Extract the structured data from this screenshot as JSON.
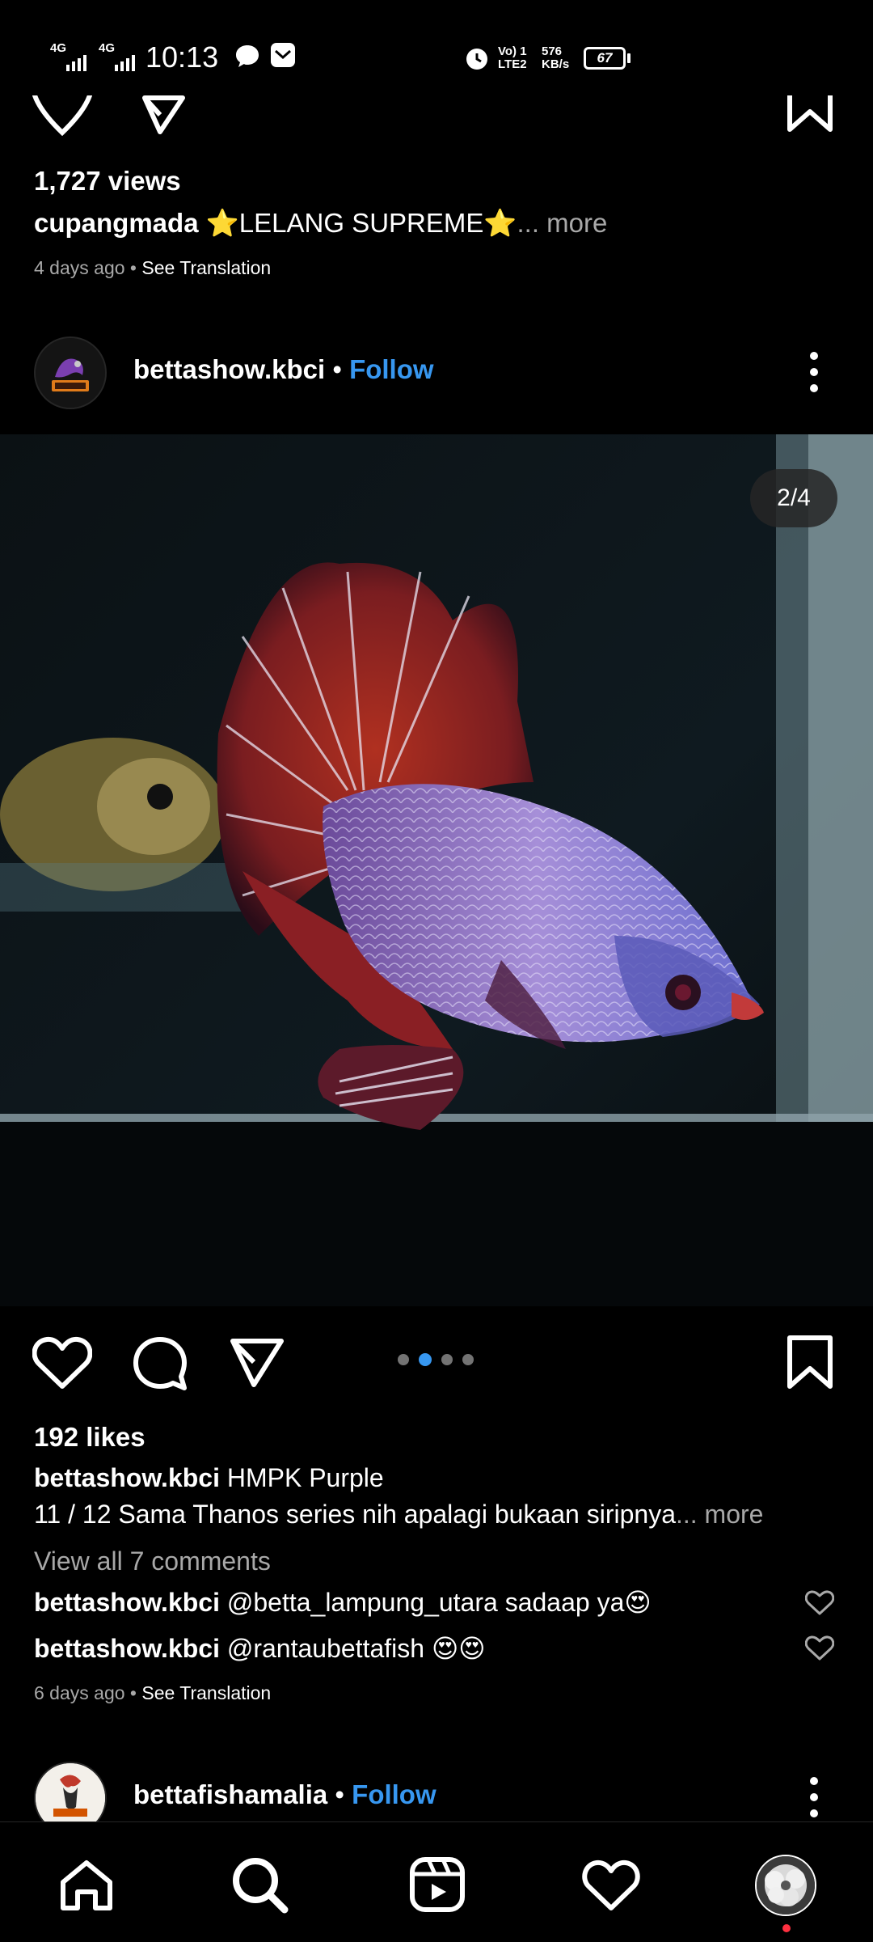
{
  "status_bar": {
    "time": "10:13",
    "net1": "4G",
    "net2": "4G",
    "volte_top": "Vo) 1",
    "volte_bottom": "LTE2",
    "speed_value": "576",
    "speed_unit": "KB/s",
    "battery": "67"
  },
  "prev_post": {
    "views": "1,727 views",
    "caption_user": "cupangmada",
    "caption_text": "⭐LELANG SUPREME⭐",
    "caption_more": "... more",
    "time": "4 days ago",
    "see_translation": "See Translation"
  },
  "post": {
    "username": "bettashow.kbci",
    "follow": "Follow",
    "counter": "2/4",
    "likes": "192 likes",
    "caption_title": "HMPK Purple",
    "caption_line2": "11 / 12 Sama Thanos series nih apalagi bukaan siripnya",
    "caption_more": "... more",
    "view_comments": "View all 7 comments",
    "comments": [
      {
        "user": "bettashow.kbci",
        "text": "@betta_lampung_utara sadaap ya😍"
      },
      {
        "user": "bettashow.kbci",
        "text": "@rantaubettafish 😍😍"
      }
    ],
    "time": "6 days ago",
    "see_translation": "See Translation",
    "carousel": {
      "total": 4,
      "active": 2
    }
  },
  "next_post": {
    "username": "bettafishamalia",
    "follow": "Follow"
  },
  "nav": [
    "home-icon",
    "search-icon",
    "reels-icon",
    "activity-heart-icon",
    "profile-avatar"
  ],
  "colors": {
    "accent": "#3797f0",
    "muted": "#a8a8a8",
    "notification_dot": "#ff3040"
  }
}
